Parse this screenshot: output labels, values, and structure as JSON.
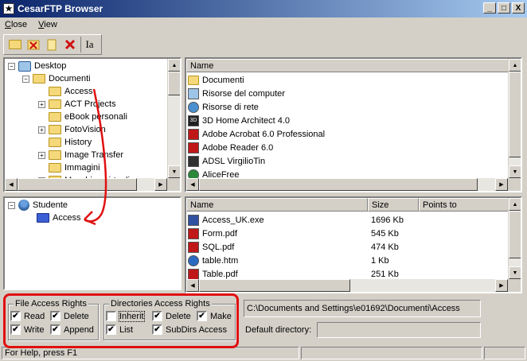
{
  "window": {
    "title": "CesarFTP Browser",
    "minimize": "_",
    "maximize": "□",
    "close": "X"
  },
  "menu": {
    "close": "Close",
    "view": "View"
  },
  "toolbar": {
    "text_button": "Ia"
  },
  "local_tree": {
    "items": [
      {
        "label": "Desktop",
        "expander": "−"
      },
      {
        "label": "Documenti",
        "expander": "−"
      },
      {
        "label": "Access",
        "expander": ""
      },
      {
        "label": "ACT Projects",
        "expander": "+"
      },
      {
        "label": "eBook personali",
        "expander": ""
      },
      {
        "label": "FotoVision",
        "expander": "+"
      },
      {
        "label": "History",
        "expander": ""
      },
      {
        "label": "Image Transfer",
        "expander": "+"
      },
      {
        "label": "Immagini",
        "expander": ""
      },
      {
        "label": "Macchine virtuali",
        "expander": "+"
      }
    ]
  },
  "local_list": {
    "header_name": "Name",
    "items": [
      {
        "label": "Documenti",
        "icon": "folder-icon",
        "color": "#f4d87a"
      },
      {
        "label": "Risorse del computer",
        "icon": "computer-icon",
        "color": "#9ec4e8"
      },
      {
        "label": "Risorse di rete",
        "icon": "network-icon",
        "color": "#4a90d0"
      },
      {
        "label": "3D Home Architect 4.0",
        "icon": "app-icon",
        "color": "#202020"
      },
      {
        "label": "Adobe Acrobat 6.0 Professional",
        "icon": "acrobat-icon",
        "color": "#c01818"
      },
      {
        "label": "Adobe Reader 6.0",
        "icon": "reader-icon",
        "color": "#c01818"
      },
      {
        "label": "ADSL VirgilioTin",
        "icon": "adsl-icon",
        "color": "#303030"
      },
      {
        "label": "AliceFree",
        "icon": "globe-icon",
        "color": "#2a8a3a"
      }
    ]
  },
  "user_tree": {
    "items": [
      {
        "label": "Studente",
        "expander": "−"
      },
      {
        "label": "Access",
        "expander": ""
      }
    ]
  },
  "remote_list": {
    "header_name": "Name",
    "header_size": "Size",
    "header_points": "Points to",
    "rows": [
      {
        "name": "Access_UK.exe",
        "size": "1696 Kb",
        "icon": "exe-icon",
        "color": "#3050a0"
      },
      {
        "name": "Form.pdf",
        "size": "545 Kb",
        "icon": "pdf-icon",
        "color": "#c01818"
      },
      {
        "name": "SQL.pdf",
        "size": "474 Kb",
        "icon": "pdf-icon",
        "color": "#c01818"
      },
      {
        "name": "table.htm",
        "size": "1 Kb",
        "icon": "html-icon",
        "color": "#2a6ac0"
      },
      {
        "name": "Table.pdf",
        "size": "251 Kb",
        "icon": "pdf-icon",
        "color": "#c01818"
      }
    ]
  },
  "file_rights": {
    "label": "File Access Rights",
    "read": {
      "label": "Read",
      "checked": "✔"
    },
    "delete": {
      "label": "Delete",
      "checked": "✔"
    },
    "write": {
      "label": "Write",
      "checked": "✔"
    },
    "append": {
      "label": "Append",
      "checked": "✔"
    }
  },
  "dir_rights": {
    "label": "Directories Access Rights",
    "inherit": {
      "label": "Inherit",
      "checked": ""
    },
    "delete": {
      "label": "Delete",
      "checked": "✔"
    },
    "make": {
      "label": "Make",
      "checked": "✔"
    },
    "list": {
      "label": "List",
      "checked": "✔"
    },
    "subdirs": {
      "label": "SubDirs Access",
      "checked": "✔"
    }
  },
  "path_field": "C:\\Documents and Settings\\e01692\\Documenti\\Access",
  "default_dir": {
    "label": "Default directory:",
    "value": ""
  },
  "status": {
    "text": "For Help, press F1"
  },
  "annotation_colors": {
    "highlight": "#e01010"
  }
}
